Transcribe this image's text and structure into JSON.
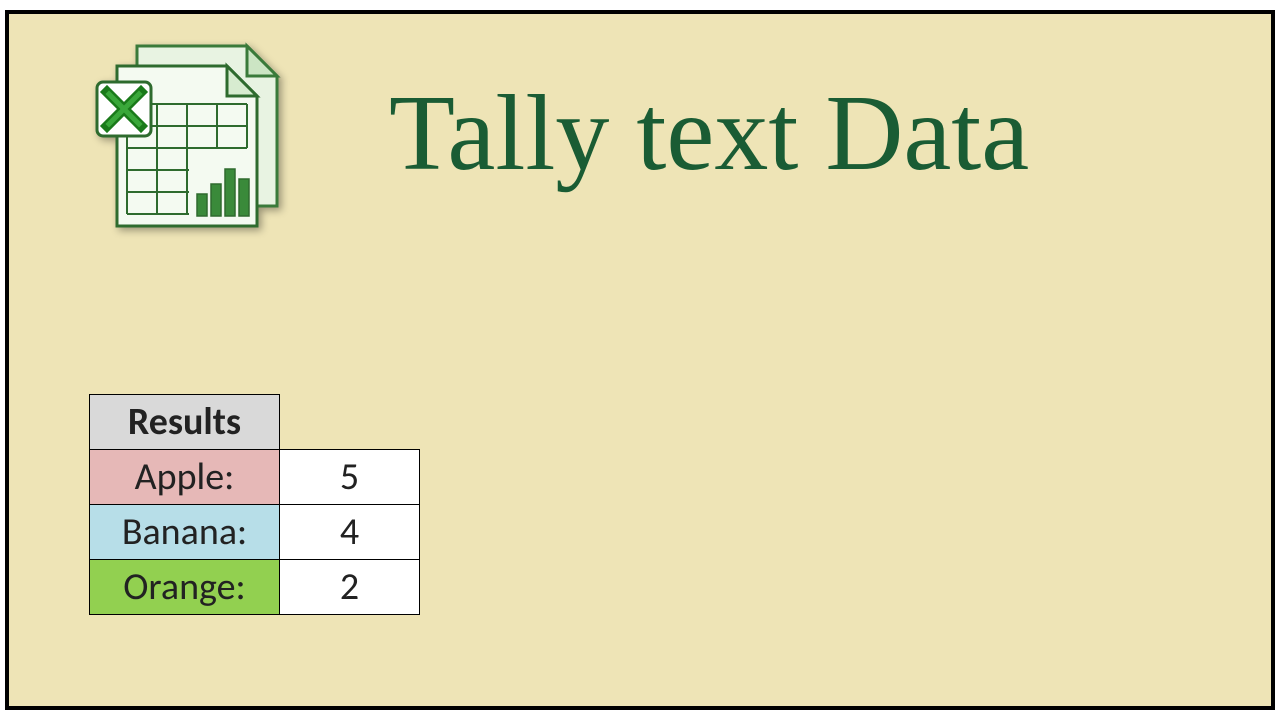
{
  "title": "Tally text Data",
  "table": {
    "header": "Results",
    "rows": [
      {
        "label": "Apple:",
        "value": 5,
        "colorClass": "apple-row"
      },
      {
        "label": "Banana:",
        "value": 4,
        "colorClass": "banana-row"
      },
      {
        "label": "Orange:",
        "value": 2,
        "colorClass": "orange-row"
      }
    ]
  }
}
